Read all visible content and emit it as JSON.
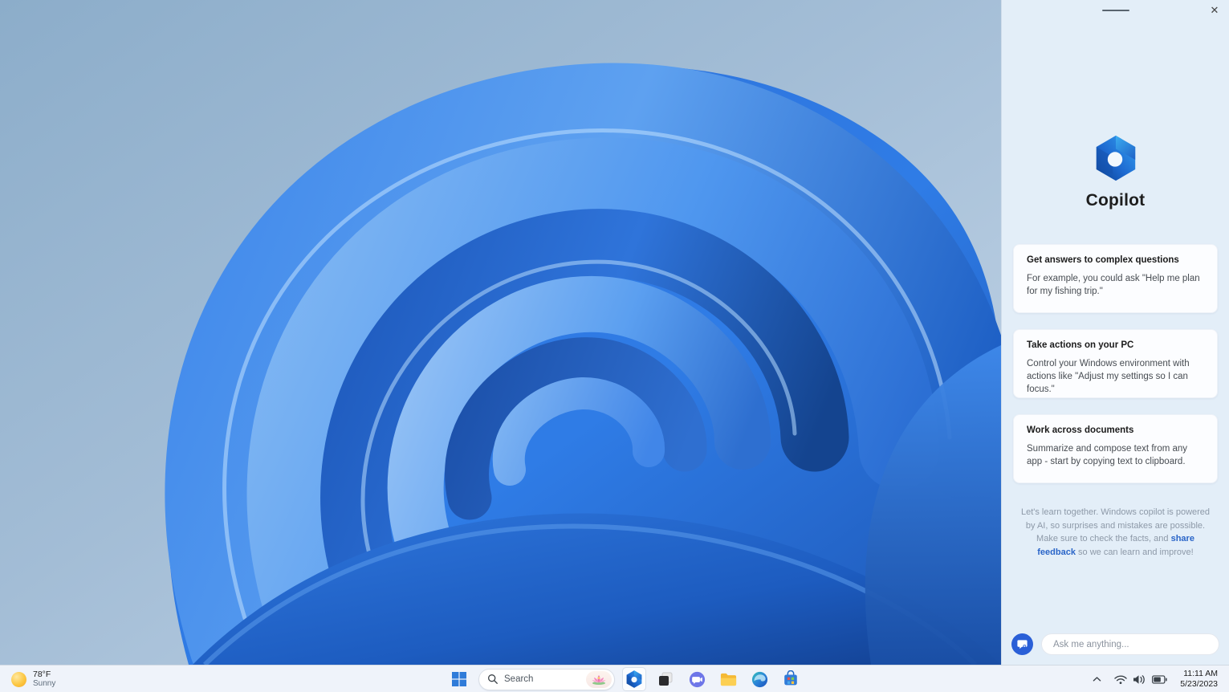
{
  "sidebar": {
    "title": "Copilot",
    "window_controls": {
      "minimize": "minimize",
      "close_glyph": "✕"
    },
    "cards": [
      {
        "title": "Get answers to complex questions",
        "body": "For example, you could ask \"Help me plan for my fishing trip.\""
      },
      {
        "title": "Take actions on your PC",
        "body": "Control your Windows environment with actions like \"Adjust my settings so I can focus.\""
      },
      {
        "title": "Work across documents",
        "body": "Summarize and compose text from any app - start by copying text to clipboard."
      }
    ],
    "disclaimer": {
      "before_link": "Let's learn together. Windows copilot is powered by AI, so surprises and mistakes are possible. Make sure to check the facts, and ",
      "link": "share feedback",
      "after_link": " so we can learn and improve!"
    },
    "input": {
      "placeholder": "Ask me anything..."
    }
  },
  "taskbar": {
    "widgets": {
      "temperature": "78°F",
      "condition": "Sunny"
    },
    "search": {
      "placeholder": "Search"
    },
    "apps": [
      "start",
      "search",
      "copilot",
      "task-view",
      "chat",
      "file-explorer",
      "edge",
      "microsoft-store"
    ],
    "active_app": "copilot",
    "tray": {
      "time": "11:11 AM",
      "date": "5/23/2023",
      "icons": [
        "hidden-icons-chevron",
        "wifi",
        "volume",
        "battery"
      ]
    }
  },
  "colors": {
    "sidebar_bg": "#e3eef8",
    "card_bg": "#fcfdff",
    "accent_blue": "#2a5fd7",
    "link_blue": "#2a65c8",
    "taskbar_bg": "#eff3fa",
    "wallpaper_blue": "#2e79e2",
    "wallpaper_sky": "#8fafcc"
  }
}
